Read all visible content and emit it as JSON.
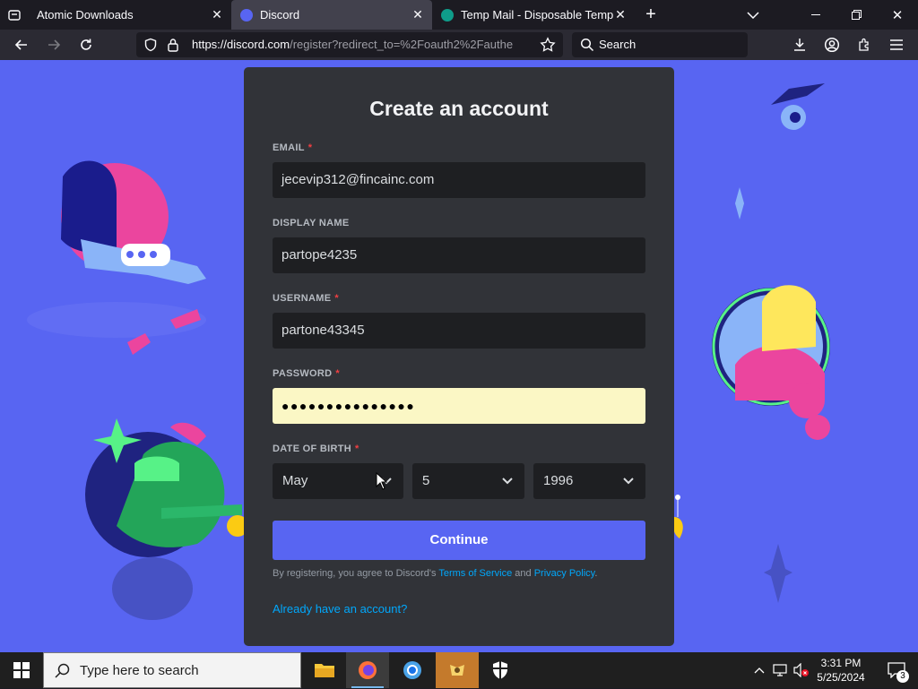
{
  "browser": {
    "tabs": [
      {
        "title": "Atomic Downloads",
        "active": false
      },
      {
        "title": "Discord",
        "active": true
      },
      {
        "title": "Temp Mail - Disposable Tempora",
        "active": false
      }
    ],
    "url_host": "https://discord.com",
    "url_path": "/register?redirect_to=%2Foauth2%2Fauthe",
    "search_placeholder": "Search"
  },
  "form": {
    "title": "Create an account",
    "email_label": "EMAIL",
    "email_value": "jecevip312@fincainc.com",
    "display_name_label": "DISPLAY NAME",
    "display_name_value": "partope4235",
    "username_label": "USERNAME",
    "username_value": "partone43345",
    "password_label": "PASSWORD",
    "password_value": "●●●●●●●●●●●●●●●",
    "dob_label": "DATE OF BIRTH",
    "required_mark": "*",
    "dob_month": "May",
    "dob_day": "5",
    "dob_year": "1996",
    "continue_label": "Continue",
    "legal_prefix": "By registering, you agree to Discord's ",
    "terms_link": "Terms of Service",
    "legal_and": " and ",
    "privacy_link": "Privacy Policy",
    "legal_suffix": ".",
    "login_link": "Already have an account?"
  },
  "taskbar": {
    "search_placeholder": "Type here to search",
    "time": "3:31 PM",
    "date": "5/25/2024",
    "notification_count": "3"
  },
  "colors": {
    "discord_blurple": "#5865f2",
    "card_bg": "#313338",
    "input_bg": "#1e1f22",
    "link": "#00a8fc",
    "required": "#f23f42",
    "autofill": "#fbf7c5"
  }
}
